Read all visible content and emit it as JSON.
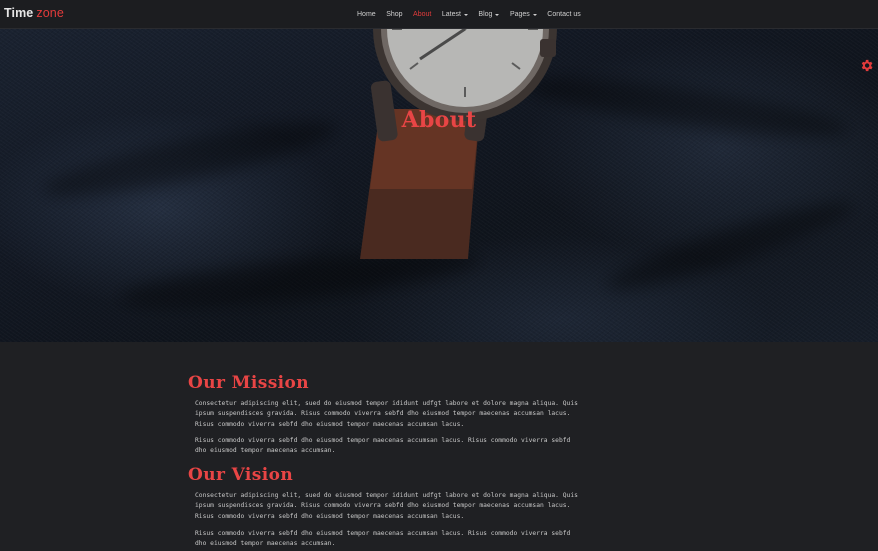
{
  "brand": {
    "part1": "Time",
    "part2": "zone"
  },
  "nav": {
    "items": [
      {
        "label": "Home",
        "dropdown": false,
        "active": false
      },
      {
        "label": "Shop",
        "dropdown": false,
        "active": false
      },
      {
        "label": "About",
        "dropdown": false,
        "active": true
      },
      {
        "label": "Latest",
        "dropdown": true,
        "active": false
      },
      {
        "label": "Blog",
        "dropdown": true,
        "active": false
      },
      {
        "label": "Pages",
        "dropdown": true,
        "active": false
      },
      {
        "label": "Contact us",
        "dropdown": false,
        "active": false
      }
    ]
  },
  "hero": {
    "title": "About"
  },
  "settings": {
    "icon": "gear-icon",
    "color": "#e23b3b"
  },
  "colors": {
    "accent": "#e84545",
    "background": "#1f2023"
  },
  "sections": [
    {
      "title": "Our Mission",
      "paragraphs": [
        "Consectetur adipiscing elit, sued do eiusmod tempor ididunt udfgt labore et dolore magna aliqua. Quis ipsum suspendisces gravida. Risus commodo viverra sebfd dho eiusmod tempor maecenas accumsan lacus. Risus commodo viverra sebfd dho eiusmod tempor maecenas accumsan lacus.",
        "Risus commodo viverra sebfd dho eiusmod tempor maecenas accumsan lacus. Risus commodo viverra sebfd dho eiusmod tempor maecenas accumsan."
      ]
    },
    {
      "title": "Our Vision",
      "paragraphs": [
        "Consectetur adipiscing elit, sued do eiusmod tempor ididunt udfgt labore et dolore magna aliqua. Quis ipsum suspendisces gravida. Risus commodo viverra sebfd dho eiusmod tempor maecenas accumsan lacus. Risus commodo viverra sebfd dho eiusmod tempor maecenas accumsan lacus.",
        "Risus commodo viverra sebfd dho eiusmod tempor maecenas accumsan lacus. Risus commodo viverra sebfd dho eiusmod tempor maecenas accumsan."
      ]
    }
  ]
}
